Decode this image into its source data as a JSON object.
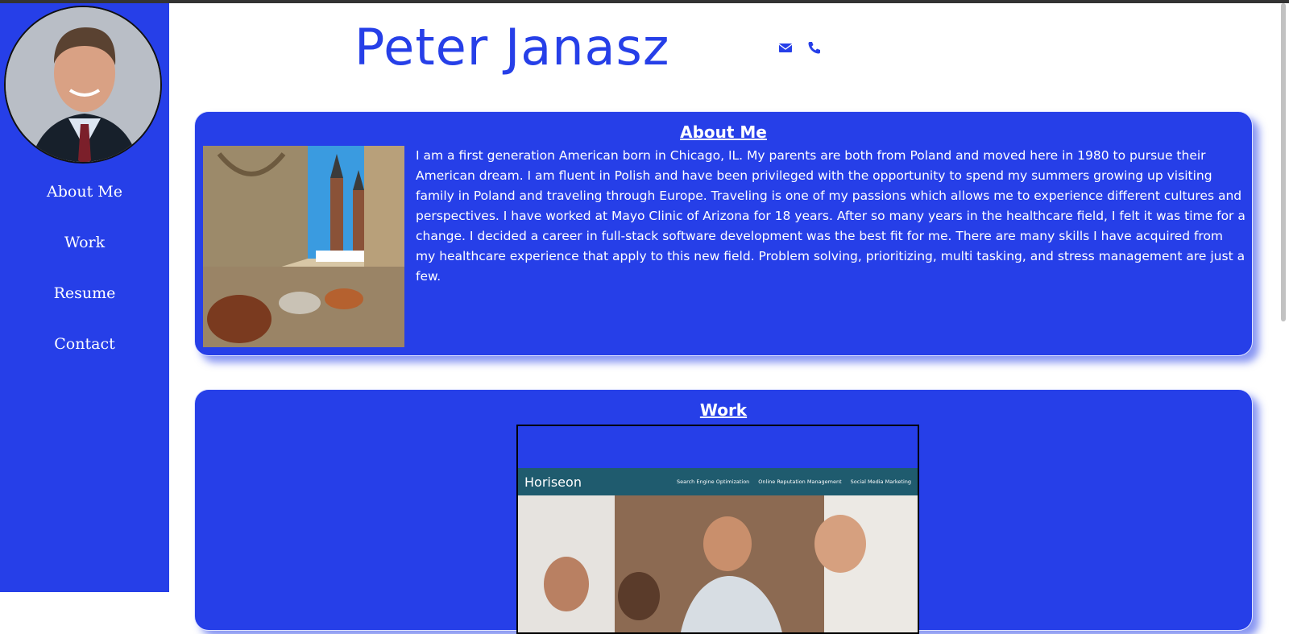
{
  "header": {
    "name": "Peter Janasz"
  },
  "icons": {
    "email": "envelope-icon",
    "phone": "phone-icon",
    "accent": "#263fe8"
  },
  "nav": {
    "items": [
      {
        "label": "About Me"
      },
      {
        "label": "Work"
      },
      {
        "label": "Resume"
      },
      {
        "label": "Contact"
      }
    ]
  },
  "about": {
    "title": "About Me",
    "text": "I am a first generation American born in Chicago, IL. My parents are both from Poland and moved here in 1980 to pursue their American dream. I am fluent in Polish and have been privileged with the opportunity to spend my summers growing up visiting family in Poland and traveling through Europe. Traveling is one of my passions which allows me to experience different cultures and perspectives. I have worked at Mayo Clinic of Arizona for 18 years. After so many years in the healthcare field, I felt it was time for a change. I decided a career in full-stack software development was the best fit for me. There are many skills I have acquired from my healthcare experience that apply to this new field. Problem solving, prioritizing, multi tasking, and stress management are just a few."
  },
  "work": {
    "title": "Work",
    "project": {
      "logo": "Horiseon",
      "nav": [
        "Search Engine Optimization",
        "Online Reputation Management",
        "Social Media Marketing"
      ]
    }
  }
}
